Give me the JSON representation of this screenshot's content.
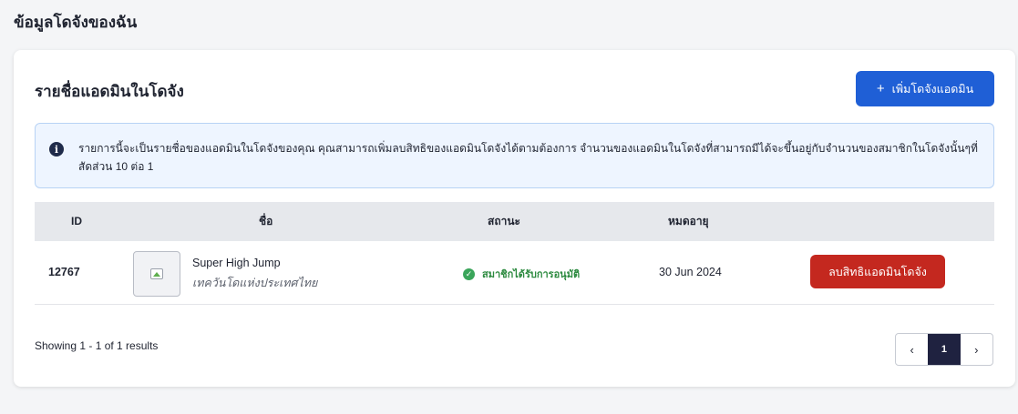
{
  "page": {
    "title": "ข้อมูลโดจังของฉัน"
  },
  "card": {
    "title": "รายชื่อแอดมินในโดจัง",
    "add_button_label": "เพิ่มโดจังแอดมิน",
    "add_button_icon": "plus-icon",
    "accent_color": "#1f5fd6"
  },
  "info": {
    "icon": "info-icon",
    "text": "รายการนี้จะเป็นรายชื่อของแอดมินในโดจังของคุณ คุณสามารถเพิ่มลบสิทธิของแอดมินโดจังได้ตามต้องการ จำนวนของแอดมินในโดจังที่สามารถมีได้จะขึ้นอยู่กับจำนวนของสมาชิกในโดจังนั้นๆที่สัดส่วน 10 ต่อ 1"
  },
  "table": {
    "headers": {
      "id": "ID",
      "name": "ชื่อ",
      "status": "สถานะ",
      "expiry": "หมดอายุ"
    },
    "rows": [
      {
        "id": "12767",
        "name": "Super High Jump",
        "subtitle": "เทควันโดแห่งประเทศไทย",
        "status": "สมาชิกได้รับการอนุมัติ",
        "status_color": "#2c8a3f",
        "expiry": "30 Jun 2024",
        "action_label": "ลบสิทธิแอดมินโดจัง",
        "action_color": "#c4281f"
      }
    ]
  },
  "footer": {
    "results_text": "Showing 1 - 1 of 1 results",
    "pagination": {
      "prev": "‹",
      "current": "1",
      "next": "›"
    }
  }
}
